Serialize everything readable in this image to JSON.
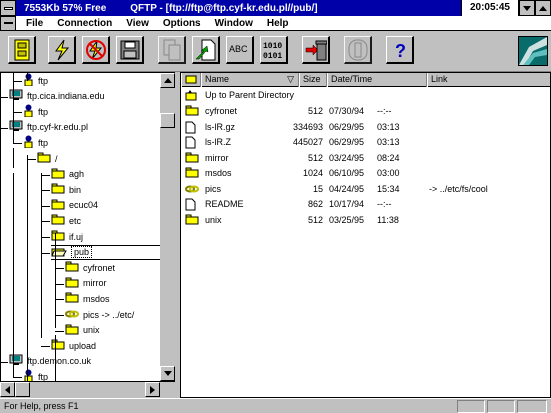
{
  "window": {
    "memory_status": "7553Kb 57% Free",
    "title": "QFTP - [ftp://ftp@ftp.cyf-kr.edu.pl//pub/]",
    "clock": "20:05:45"
  },
  "menu": [
    "File",
    "Connection",
    "View",
    "Options",
    "Window",
    "Help"
  ],
  "toolbar": {
    "buttons": [
      {
        "name": "connect-cabinet-button",
        "icon": "file-cabinet-icon"
      },
      {
        "name": "quick-connect-button",
        "icon": "lightning-icon"
      },
      {
        "name": "disconnect-button",
        "icon": "no-lightning-icon"
      },
      {
        "name": "save-button",
        "icon": "floppy-disk-icon"
      },
      {
        "name": "copy-button",
        "icon": "copy-pages-icon"
      },
      {
        "name": "transfer-button",
        "icon": "transfer-arrow-icon"
      },
      {
        "name": "rename-button",
        "icon": "abc-rename-icon"
      },
      {
        "name": "binary-mode-button",
        "icon": "binary-icon"
      },
      {
        "name": "delete-button",
        "icon": "trash-icon"
      },
      {
        "name": "stop-button",
        "icon": "stop-hand-icon"
      },
      {
        "name": "help-button",
        "icon": "question-mark-icon"
      }
    ],
    "binary_label_top": "1010",
    "binary_label_bottom": "0101",
    "help_label": "?",
    "rename_label": "ABC"
  },
  "tree": [
    {
      "label": "ftp",
      "type": "user"
    },
    {
      "label": "ftp.cica.indiana.edu",
      "type": "host"
    },
    {
      "label": "ftp",
      "type": "user"
    },
    {
      "label": "ftp.cyf-kr.edu.pl",
      "type": "host"
    },
    {
      "label": "ftp",
      "type": "user"
    },
    {
      "label": "/",
      "type": "folder"
    },
    {
      "label": "agh",
      "type": "folder"
    },
    {
      "label": "bin",
      "type": "folder"
    },
    {
      "label": "ecuc04",
      "type": "folder"
    },
    {
      "label": "etc",
      "type": "folder"
    },
    {
      "label": "if.uj",
      "type": "folder"
    },
    {
      "label": "pub",
      "type": "folder-open",
      "selected": true
    },
    {
      "label": "cyfronet",
      "type": "folder"
    },
    {
      "label": "mirror",
      "type": "folder"
    },
    {
      "label": "msdos",
      "type": "folder"
    },
    {
      "label": "pics -> ../etc/",
      "type": "link"
    },
    {
      "label": "unix",
      "type": "folder"
    },
    {
      "label": "upload",
      "type": "folder"
    },
    {
      "label": "ftp.demon.co.uk",
      "type": "host"
    },
    {
      "label": "ftp",
      "type": "user"
    }
  ],
  "list": {
    "columns": {
      "name": "Name",
      "size": "Size",
      "datetime": "Date/Time",
      "link": "Link"
    },
    "parent_label": "Up to Parent Directory",
    "rows": [
      {
        "name": "cyfronet",
        "size": "512",
        "date": "07/30/94",
        "time": "--:--",
        "link": "",
        "type": "folder"
      },
      {
        "name": "ls-lR.gz",
        "size": "334693",
        "date": "06/29/95",
        "time": "03:13",
        "link": "",
        "type": "file"
      },
      {
        "name": "ls-lR.Z",
        "size": "445027",
        "date": "06/29/95",
        "time": "03:13",
        "link": "",
        "type": "file"
      },
      {
        "name": "mirror",
        "size": "512",
        "date": "03/24/95",
        "time": "08:24",
        "link": "",
        "type": "folder"
      },
      {
        "name": "msdos",
        "size": "1024",
        "date": "06/10/95",
        "time": "03:00",
        "link": "",
        "type": "folder"
      },
      {
        "name": "pics",
        "size": "15",
        "date": "04/24/95",
        "time": "15:34",
        "link": "-> ../etc/fs/cool",
        "type": "link"
      },
      {
        "name": "README",
        "size": "862",
        "date": "10/17/94",
        "time": "--:--",
        "link": "",
        "type": "file"
      },
      {
        "name": "unix",
        "size": "512",
        "date": "03/25/95",
        "time": "11:38",
        "link": "",
        "type": "folder"
      }
    ]
  },
  "status": {
    "text": "For Help, press F1"
  }
}
